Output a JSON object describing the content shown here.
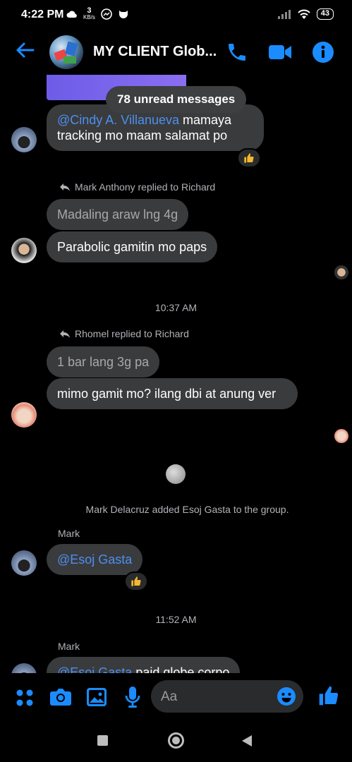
{
  "status": {
    "time": "4:22 PM",
    "speed_value": "3",
    "speed_unit": "KB/s",
    "battery": "43"
  },
  "header": {
    "title": "MY CLIENT Glob..."
  },
  "chat": {
    "unread_pill": "78 unread messages",
    "msg1": {
      "mention": "@Cindy A. Villanueva",
      "text": " mamaya tracking mo maam salamat po"
    },
    "reply1": {
      "note": "Mark Anthony replied to Richard",
      "quoted": "Madaling araw lng 4g",
      "text": "Parabolic gamitin mo paps"
    },
    "time1": "10:37 AM",
    "reply2": {
      "note": "Rhomel replied to Richard",
      "quoted": "1 bar lang 3g pa",
      "text": "mimo gamit mo? ilang dbi at anung ver"
    },
    "system_add": "Mark Delacruz added Esoj Gasta to the group.",
    "mark1": {
      "sender": "Mark",
      "mention": "@Esoj Gasta"
    },
    "time2": "11:52 AM",
    "mark2": {
      "sender": "Mark",
      "mention": "@Esoj Gasta",
      "text": " paid globe corpo"
    }
  },
  "composer": {
    "placeholder": "Aa"
  },
  "colors": {
    "accent": "#1a8cff",
    "bubble": "#3a3b3c",
    "mention": "#4d8ff0"
  }
}
